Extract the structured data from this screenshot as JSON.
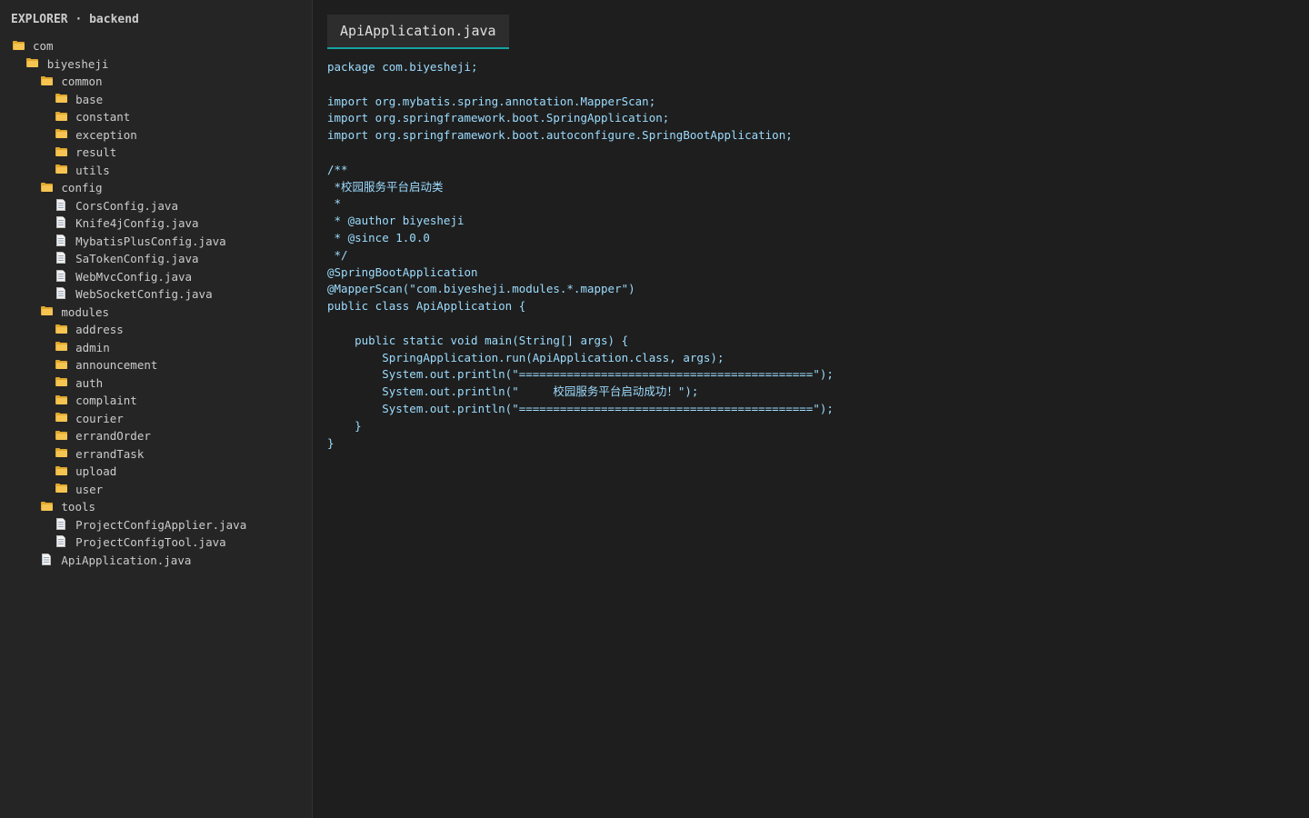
{
  "explorer": {
    "title": "EXPLORER · backend"
  },
  "tree": [
    {
      "label": "com",
      "type": "folder",
      "depth": 0
    },
    {
      "label": "biyesheji",
      "type": "folder",
      "depth": 1
    },
    {
      "label": "common",
      "type": "folder",
      "depth": 2
    },
    {
      "label": "base",
      "type": "folder",
      "depth": 3
    },
    {
      "label": "constant",
      "type": "folder",
      "depth": 3
    },
    {
      "label": "exception",
      "type": "folder",
      "depth": 3
    },
    {
      "label": "result",
      "type": "folder",
      "depth": 3
    },
    {
      "label": "utils",
      "type": "folder",
      "depth": 3
    },
    {
      "label": "config",
      "type": "folder",
      "depth": 2
    },
    {
      "label": "CorsConfig.java",
      "type": "file",
      "depth": 3
    },
    {
      "label": "Knife4jConfig.java",
      "type": "file",
      "depth": 3
    },
    {
      "label": "MybatisPlusConfig.java",
      "type": "file",
      "depth": 3
    },
    {
      "label": "SaTokenConfig.java",
      "type": "file",
      "depth": 3
    },
    {
      "label": "WebMvcConfig.java",
      "type": "file",
      "depth": 3
    },
    {
      "label": "WebSocketConfig.java",
      "type": "file",
      "depth": 3
    },
    {
      "label": "modules",
      "type": "folder",
      "depth": 2
    },
    {
      "label": "address",
      "type": "folder",
      "depth": 3
    },
    {
      "label": "admin",
      "type": "folder",
      "depth": 3
    },
    {
      "label": "announcement",
      "type": "folder",
      "depth": 3
    },
    {
      "label": "auth",
      "type": "folder",
      "depth": 3
    },
    {
      "label": "complaint",
      "type": "folder",
      "depth": 3
    },
    {
      "label": "courier",
      "type": "folder",
      "depth": 3
    },
    {
      "label": "errandOrder",
      "type": "folder",
      "depth": 3
    },
    {
      "label": "errandTask",
      "type": "folder",
      "depth": 3
    },
    {
      "label": "upload",
      "type": "folder",
      "depth": 3
    },
    {
      "label": "user",
      "type": "folder",
      "depth": 3
    },
    {
      "label": "tools",
      "type": "folder",
      "depth": 2
    },
    {
      "label": "ProjectConfigApplier.java",
      "type": "file",
      "depth": 3
    },
    {
      "label": "ProjectConfigTool.java",
      "type": "file",
      "depth": 3
    },
    {
      "label": "ApiApplication.java",
      "type": "file",
      "depth": 2
    }
  ],
  "editor": {
    "tab_label": "ApiApplication.java",
    "code_lines": [
      "package com.biyesheji;",
      "",
      "import org.mybatis.spring.annotation.MapperScan;",
      "import org.springframework.boot.SpringApplication;",
      "import org.springframework.boot.autoconfigure.SpringBootApplication;",
      "",
      "/**",
      " *校园服务平台启动类",
      " *",
      " * @author biyesheji",
      " * @since 1.0.0",
      " */",
      "@SpringBootApplication",
      "@MapperScan(\"com.biyesheji.modules.*.mapper\")",
      "public class ApiApplication {",
      "",
      "    public static void main(String[] args) {",
      "        SpringApplication.run(ApiApplication.class, args);",
      "        System.out.println(\"===========================================\");",
      "        System.out.println(\"     校园服务平台启动成功！\");",
      "        System.out.println(\"===========================================\");",
      "    }",
      "}"
    ]
  },
  "colors": {
    "sidebar_bg": "#252526",
    "editor_bg": "#1e1e1e",
    "code_text": "#9cdcfe",
    "tab_accent": "#17a2a2",
    "folder_icon": "#f5c451"
  }
}
